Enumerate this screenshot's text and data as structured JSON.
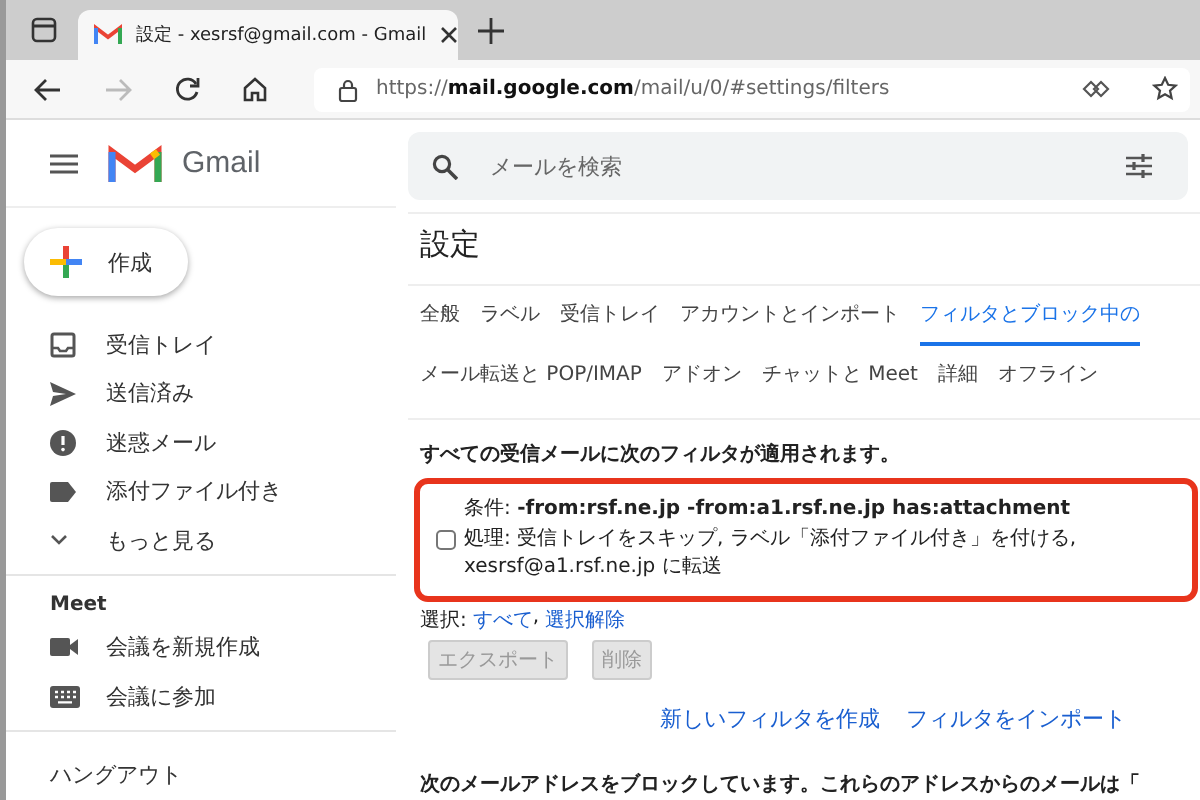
{
  "browser": {
    "tab": {
      "title": "設定 - xesrsf@gmail.com - Gmail",
      "selected": true
    },
    "url": "https://**mail.google.com**/mail/u/0/#settings/filters",
    "forward_disabled": true
  },
  "app": {
    "name": "Gmail"
  },
  "search": {
    "placeholder": "メールを検索"
  },
  "compose": {
    "label": "作成"
  },
  "sidebar": {
    "items": [
      {
        "label": "受信トレイ",
        "kind": "inbox"
      },
      {
        "label": "送信済み",
        "kind": "sent"
      },
      {
        "label": "迷惑メール",
        "kind": "spam"
      },
      {
        "label": "添付ファイル付き",
        "kind": "label"
      },
      {
        "label": "もっと見る",
        "kind": "more"
      }
    ],
    "meet": {
      "title": "Meet",
      "items": [
        {
          "label": "会議を新規作成",
          "kind": "video"
        },
        {
          "label": "会議に参加",
          "kind": "keyboard"
        }
      ]
    },
    "hangouts": {
      "title": "ハングアウト"
    }
  },
  "settings": {
    "title": "設定",
    "tab_rows": [
      [
        {
          "label": "全般",
          "selected": false
        },
        {
          "label": "ラベル",
          "selected": false
        },
        {
          "label": "受信トレイ",
          "selected": false
        },
        {
          "label": "アカウントとインポート",
          "selected": false
        },
        {
          "label": "フィルタとブロック中の",
          "selected": true
        }
      ],
      [
        {
          "label": "メール転送と POP/IMAP",
          "selected": false
        },
        {
          "label": "アドオン",
          "selected": false
        },
        {
          "label": "チャットと Meet",
          "selected": false
        },
        {
          "label": "詳細",
          "selected": false
        },
        {
          "label": "オフライン",
          "selected": false
        }
      ]
    ],
    "filters_heading": "すべての受信メールに次のフィルタが適用されます。",
    "filters": [
      {
        "condition": "条件: **-from:rsf.ne.jp -from:a1.rsf.ne.jp has:attachment**",
        "action": "処理: 受信トレイをスキップ, ラベル「添付ファイル付き」を付ける, xesrsf@a1.rsf.ne.jp に転送",
        "checked": false,
        "highlighted": true
      }
    ],
    "select": {
      "label": "選択:",
      "all": "すべて",
      "separator": ",",
      "none": "選択解除"
    },
    "buttons": [
      {
        "label": "エクスポート",
        "disabled": true
      },
      {
        "label": "削除",
        "disabled": true
      }
    ],
    "links": [
      "新しいフィルタを作成",
      "フィルタをインポート"
    ],
    "blocked_heading": "次のメールアドレスをブロックしています。これらのアドレスからのメールは「"
  }
}
